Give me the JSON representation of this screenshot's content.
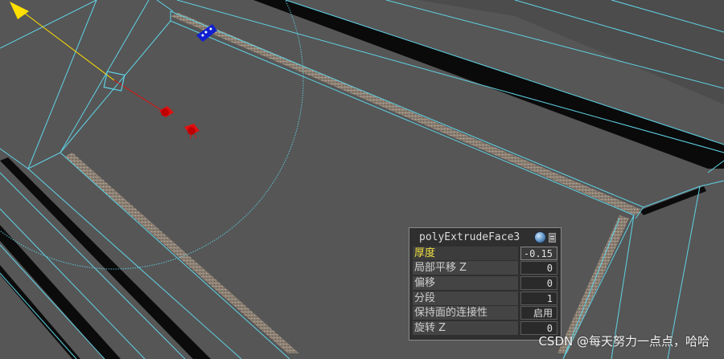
{
  "panel": {
    "title": "polyExtrudeFace3",
    "header_icons": [
      "globe-icon",
      "menu-icon"
    ],
    "rows": [
      {
        "label": "厚度",
        "value": "-0.15",
        "active": true
      },
      {
        "label": "局部平移 Z",
        "value": "0",
        "active": false
      },
      {
        "label": "偏移",
        "value": "0",
        "active": false
      },
      {
        "label": "分段",
        "value": "1",
        "active": false
      },
      {
        "label": "保持面的连接性",
        "value": "启用",
        "active": false
      },
      {
        "label": "旋转 Z",
        "value": "0",
        "active": false
      }
    ]
  },
  "watermark": "CSDN @每天努力一点点，哈哈",
  "colors": {
    "viewport_bg": "#565656",
    "wireframe": "#5fd3e6",
    "active_label": "#f0e040",
    "gizmo_yellow": "#ffe000",
    "gizmo_red": "#e01010",
    "gizmo_blue": "#1020d0"
  },
  "viewport": {
    "gizmo_icons": [
      "move-y-arrow-icon",
      "move-handle-icon",
      "scale-red-handle-icon",
      "blue-handle-icon",
      "rotate-circle-icon"
    ]
  }
}
